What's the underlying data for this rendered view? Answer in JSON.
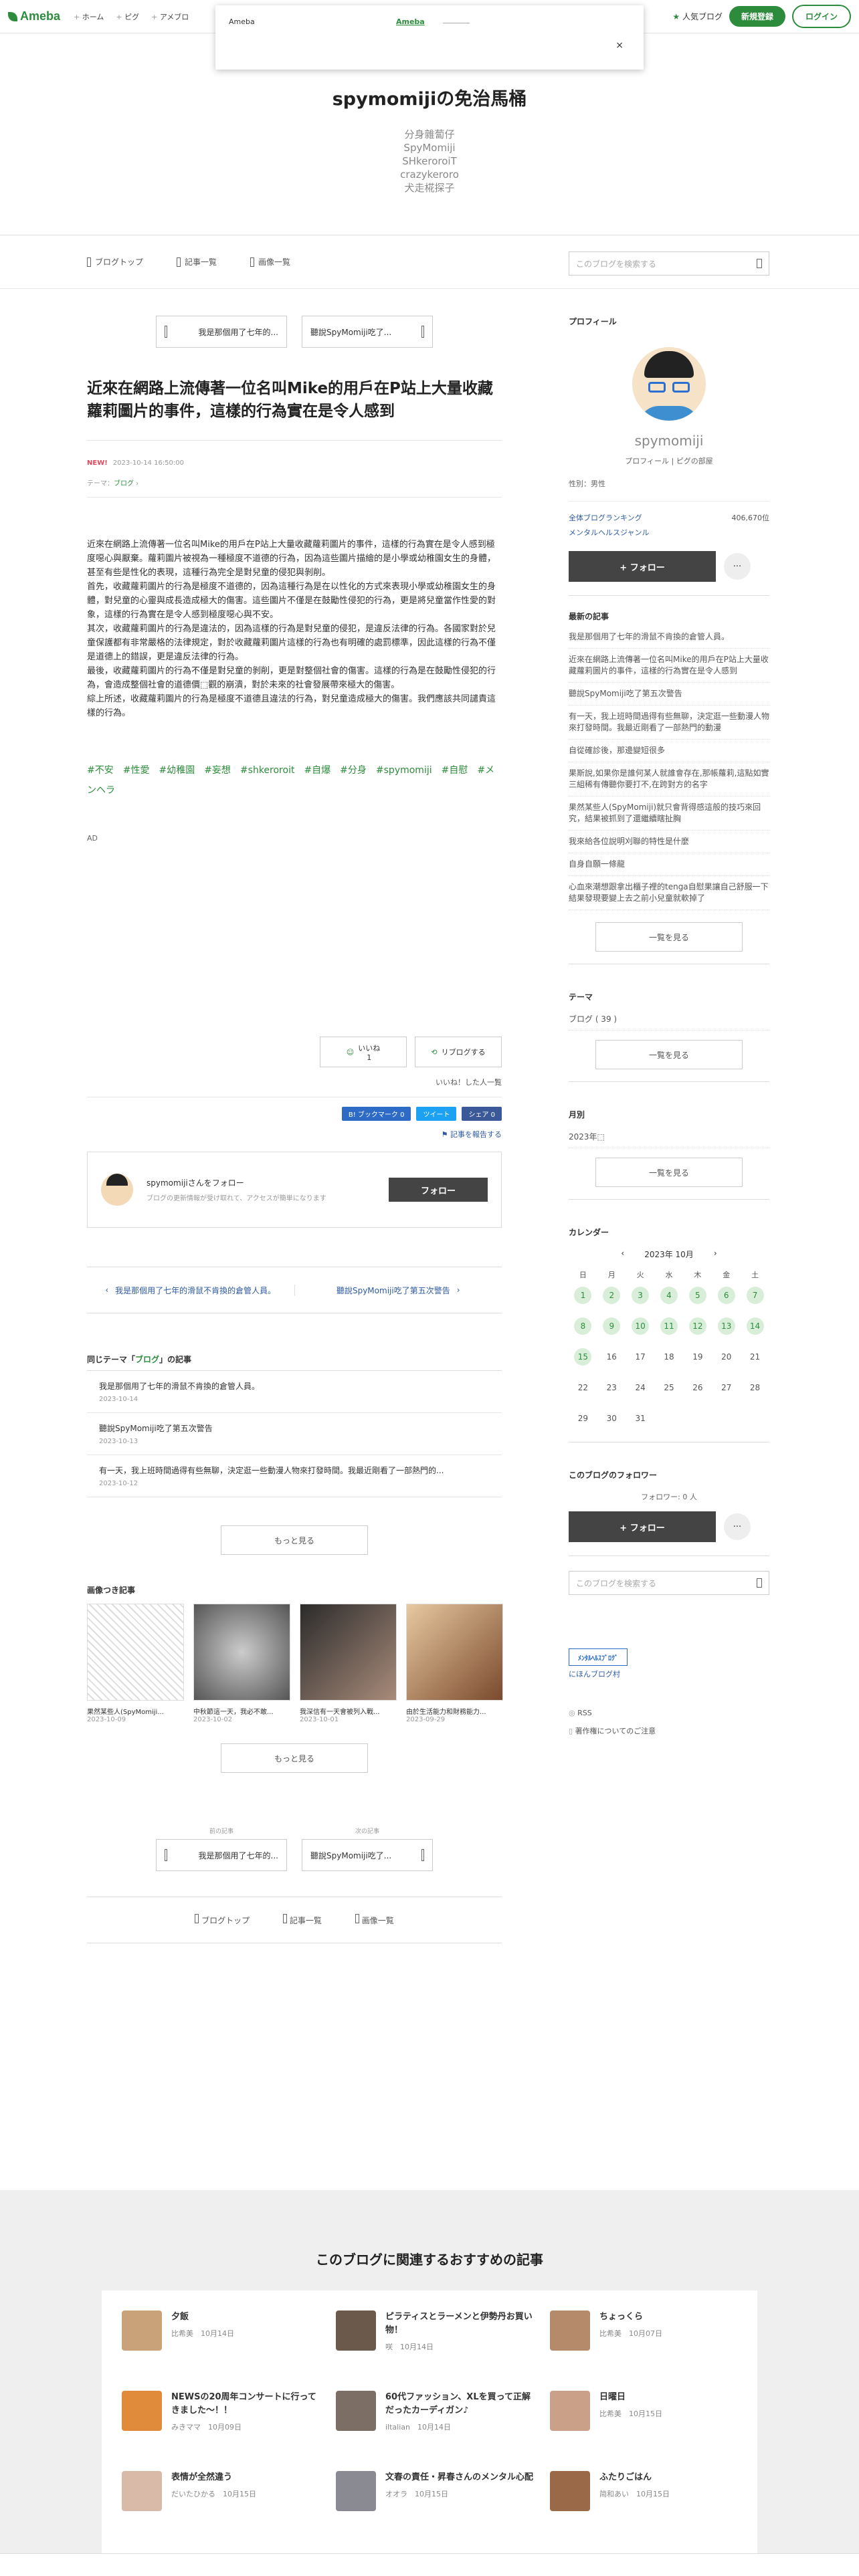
{
  "topbar": {
    "logo": "Ameba",
    "nav": [
      "ホーム",
      "ピグ",
      "アメブロ"
    ],
    "popular": "人気ブログ",
    "signup": "新規登録",
    "login": "ログイン"
  },
  "popup": {
    "title": "Ameba",
    "link": "Ameba",
    "close": "×"
  },
  "header": {
    "title": "spymomijiの免治馬桶",
    "subtitles": [
      "分身雜蔔仔",
      "SpyMomiji",
      "SHkeroroiT",
      "crazykeroro",
      "犬走椛探子"
    ]
  },
  "gnav": {
    "items": [
      "ブログトップ",
      "記事一覧",
      "画像一覧"
    ],
    "search_placeholder": "このブログを検索する"
  },
  "article": {
    "prev_btn": "我是那個用了七年的...",
    "next_btn": "聽說SpyMomiji吃了...",
    "title": "近來在網路上流傳著一位名叫Mike的用戶在P站上大量收藏蘿莉圖片的事件，這樣的行為實在是令人感到",
    "new_label": "NEW!",
    "date": "2023-10-14 16:50:00",
    "theme_label": "テーマ：",
    "theme": "ブログ",
    "paragraphs": [
      "近來在網路上流傳著一位名叫Mike的用戶在P站上大量收藏蘿莉圖片的事件，這樣的行為實在是令人感到極度噁心與厭棄。蘿莉圖片被視為一種極度不道德的行為，因為這些圖片描繪的是小學或幼稚園女生的身體，甚至有些是性化的表現，這種行為完全是對兒童的侵犯與剝削。",
      "首先，收藏蘿莉圖片的行為是極度不道德的，因為這種行為是在以性化的方式來表現小學或幼稚園女生的身體，對兒童的心靈與成長造成極大的傷害。這些圖片不僅是在鼓勵性侵犯的行為，更是將兒童當作性愛的對象，這樣的行為實在是令人感到極度噁心與不安。",
      "其次，收藏蘿莉圖片的行為是違法的，因為這樣的行為是對兒童的侵犯，是違反法律的行為。各國家對於兒童保護都有非常嚴格的法律規定，對於收藏蘿莉圖片這樣的行為也有明確的處罰標準，因此這樣的行為不僅是道德上的錯誤，更是違反法律的行為。",
      "最後，收藏蘿莉圖片的行為不僅是對兒童的剝削，更是對整個社會的傷害。這樣的行為是在鼓勵性侵犯的行為，會造成整個社會的道德價⬚觀的崩潰，對於未來的社會發展帶來極大的傷害。",
      "綜上所述，收藏蘿莉圖片的行為是極度不道德且違法的行為，對兒童造成極大的傷害。我們應該共同譴責這樣的行為。"
    ],
    "tags": "#不安　#性愛　#幼稚園　#妄想　#shkeroroit　#自爆　#分身　#spymomiji　#自慰　#メンヘラ",
    "ad": "AD",
    "like": "いいね",
    "like_count": "1",
    "reblog": "リブログする",
    "like_list": "いいね！した人一覧",
    "share": [
      "B! ブックマーク 0",
      "ツイート",
      "シェア 0"
    ],
    "share_colors": [
      "#2d6bc7",
      "#1da1f2",
      "#3b5998"
    ],
    "report": "記事を報告する"
  },
  "follow_box": {
    "title": "spymomijiさんをフォロー",
    "desc": "ブログの更新情報が受け取れて、アクセスが簡単になります",
    "button": "フォロー"
  },
  "pager": {
    "prev": "我是那個用了七年的滑鼠不肯換的倉管人員。",
    "next": "聽說SpyMomiji吃了第五次警告"
  },
  "related": {
    "heading_pre": "同じテーマ「",
    "heading_theme": "ブログ",
    "heading_post": "」の記事",
    "items": [
      {
        "title": "我是那個用了七年的滑鼠不肯換的倉管人員。",
        "date": "2023-10-14"
      },
      {
        "title": "聽說SpyMomiji吃了第五次警告",
        "date": "2023-10-13"
      },
      {
        "title": "有一天，我上班時間過得有些無聊，決定逛一些動漫人物來打發時間。我最近剛看了一部熱門的...",
        "date": "2023-10-12"
      }
    ],
    "more": "もっと見る"
  },
  "images": {
    "heading": "画像つき記事",
    "items": [
      {
        "title": "果然某些人(SpyMomiji...",
        "date": "2023-10-09"
      },
      {
        "title": "中秋節這一天，我必不敢...",
        "date": "2023-10-02"
      },
      {
        "title": "我深信有一天會被列入戰...",
        "date": "2023-10-01"
      },
      {
        "title": "由於生活能力和財務能力...",
        "date": "2023-09-29"
      }
    ],
    "more": "もっと見る"
  },
  "bottom_nav": {
    "prev_label": "前の記事",
    "next_label": "次の記事",
    "prev": "我是那個用了七年的...",
    "next": "聽說SpyMomiji吃了...",
    "items": [
      "ブログトップ",
      "記事一覧",
      "画像一覧"
    ]
  },
  "sidebar": {
    "profile_label": "プロフィール",
    "name": "spymomiji",
    "profile_link": "プロフィール",
    "pig_link": "ピグの部屋",
    "gender": "性別：男性",
    "ranking_all": "全体ブログランキング",
    "ranking_all_value": "406,670位",
    "ranking_genre": "メンタルヘルスジャンル",
    "follow": "+ フォロー",
    "dots": "···",
    "latest_label": "最新の記事",
    "latest": [
      "我是那個用了七年的滑鼠不肯換的倉管人員。",
      "近來在網路上流傳著一位名叫Mike的用戶在P站上大量收藏蘿莉圖片的事件，這樣的行為實在是令人感到",
      "聽說SpyMomiji吃了第五次警告",
      "有一天，我上班時間過得有些無聊，決定逛一些動漫人物來打發時間。我最近剛看了一部熱門的動漫",
      "自從確診後，那邊變短很多",
      "果斯說,如果你是誰何某人就誰會存在,那帳蘿莉,這點如實三組稀有傳聽你要打不,在跨對方的名字",
      "果然某些人(SpyMomiji)就只會背得感這般的技巧來回究，結果被抓到了還繼續瞎扯胸",
      "我來給各位說明刈聯的特性是什麼",
      "自身自願一條龍",
      "心血來潮想跟拿出櫃子裡的tenga自慰果讓自己舒服一下 結果發現要變上去之前小兒童就軟掉了"
    ],
    "list_more": "一覧を見る",
    "theme_label": "テーマ",
    "theme_item": "ブログ ( 39 )",
    "theme_more": "一覧を見る",
    "month_label": "月別",
    "month_item": "2023年⬚",
    "month_more": "一覧を見る",
    "calendar_label": "カレンダー",
    "calendar_month": "2023年 10月",
    "dow": [
      "日",
      "月",
      "火",
      "水",
      "木",
      "金",
      "土"
    ],
    "days": [
      "1",
      "2",
      "3",
      "4",
      "5",
      "6",
      "7",
      "8",
      "9",
      "10",
      "11",
      "12",
      "13",
      "14",
      "15",
      "16",
      "17",
      "18",
      "19",
      "20",
      "21",
      "22",
      "23",
      "24",
      "25",
      "26",
      "27",
      "28",
      "29",
      "30",
      "31"
    ],
    "linked_days": [
      "1",
      "2",
      "3",
      "4",
      "5",
      "6",
      "7",
      "8",
      "9",
      "10",
      "11",
      "12",
      "13",
      "14",
      "15"
    ],
    "followers_label": "このブログのフォロワー",
    "followers": "フォロワー: 0 人",
    "follow2": "+ フォロー",
    "search_placeholder": "このブログを検索する",
    "badge": "ﾒﾝﾀﾙﾍﾙｽﾌﾞﾛｸﾞ",
    "badge_link": "にほんブログ村",
    "rss": "RSS",
    "copyright": "著作権についてのご注意"
  },
  "recommend": {
    "title": "このブログに関連するおすすめの記事",
    "items": [
      {
        "title": "夕飯",
        "meta": "比希美　10月14日",
        "color": "#c9a27a"
      },
      {
        "title": "ピラティスとラーメンと伊勢丹お買い物！",
        "meta": "咲　10月14日",
        "color": "#6b5a4b"
      },
      {
        "title": "ちょっくら",
        "meta": "比希美　10月07日",
        "color": "#b58a6a"
      },
      {
        "title": "NEWSの20周年コンサートに行ってきました～！！",
        "meta": "みきママ　10月09日",
        "color": "#e08a3c"
      },
      {
        "title": "60代ファッション、XLを買って正解だったカーディガン♪",
        "meta": "iltalian　10月14日",
        "color": "#7d6e65"
      },
      {
        "title": "日曜日",
        "meta": "比希美　10月15日",
        "color": "#caa088"
      },
      {
        "title": "表情が全然違う",
        "meta": "だいたひかる　10月15日",
        "color": "#d9b9a8"
      },
      {
        "title": "文春の責任・昇春さんのメンタル心配",
        "meta": "オオラ　10月15日",
        "color": "#8a8a92"
      },
      {
        "title": "ふたりごはん",
        "meta": "简和あい　10月15日",
        "color": "#9a6a48"
      }
    ]
  }
}
